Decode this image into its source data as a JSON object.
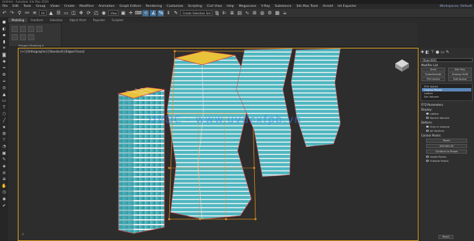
{
  "window": {
    "title": "Untitled - Autodesk 3ds Max 2020"
  },
  "menu": [
    "File",
    "Edit",
    "Tools",
    "Group",
    "Views",
    "Create",
    "Modifiers",
    "Animation",
    "Graph Editors",
    "Rendering",
    "Customize",
    "Scripting",
    "Civil View",
    "Help",
    "Megascans",
    "V-Ray",
    "Substance",
    "3ds Max Tools",
    "Arnold",
    "Int Exporter"
  ],
  "workspace": "Workspaces: Default",
  "toolbar": {
    "filter": "All",
    "view": "View",
    "selection_set": "Create Selection Set"
  },
  "ribbon": {
    "tabs": [
      "Modeling",
      "Freeform",
      "Selection",
      "Object Paint",
      "Populate",
      "Scripted"
    ],
    "active_tab": "Modeling",
    "group_label": "Polygon Modeling ▾"
  },
  "viewport": {
    "label": "[+] [Orthographic] [Standard] [Edged Faces]",
    "watermark": "UVDC - www.uvdcxfpb.vn"
  },
  "command_panel": {
    "object_name": "Object001",
    "modifier_list": "Modifier List",
    "buttons": [
      "Shell",
      "Edit Poly",
      "TurboSmooth",
      "Unwrap UVW",
      "FFD 4x4x4",
      "Edit Spline"
    ],
    "stack": [
      "FFD 4x4x4",
      "Control Points",
      "Lattice",
      "Set Volume"
    ],
    "selected_stack_index": 1,
    "params_title": "FFD Parameters",
    "display_label": "Display:",
    "display_options": [
      {
        "label": "Lattice",
        "on": true
      },
      {
        "label": "Source Volume",
        "on": false
      }
    ],
    "deform_label": "Deform:",
    "deform_options": [
      {
        "label": "Only In Volume",
        "on": true
      },
      {
        "label": "All Vertices",
        "on": false
      }
    ],
    "control_points_label": "Control Points:",
    "control_buttons": [
      "Reset",
      "Animate All",
      "Conform to Shape"
    ],
    "conform_options": [
      "Inside Points",
      "Outside Points"
    ],
    "bottom_button": "Reset"
  }
}
